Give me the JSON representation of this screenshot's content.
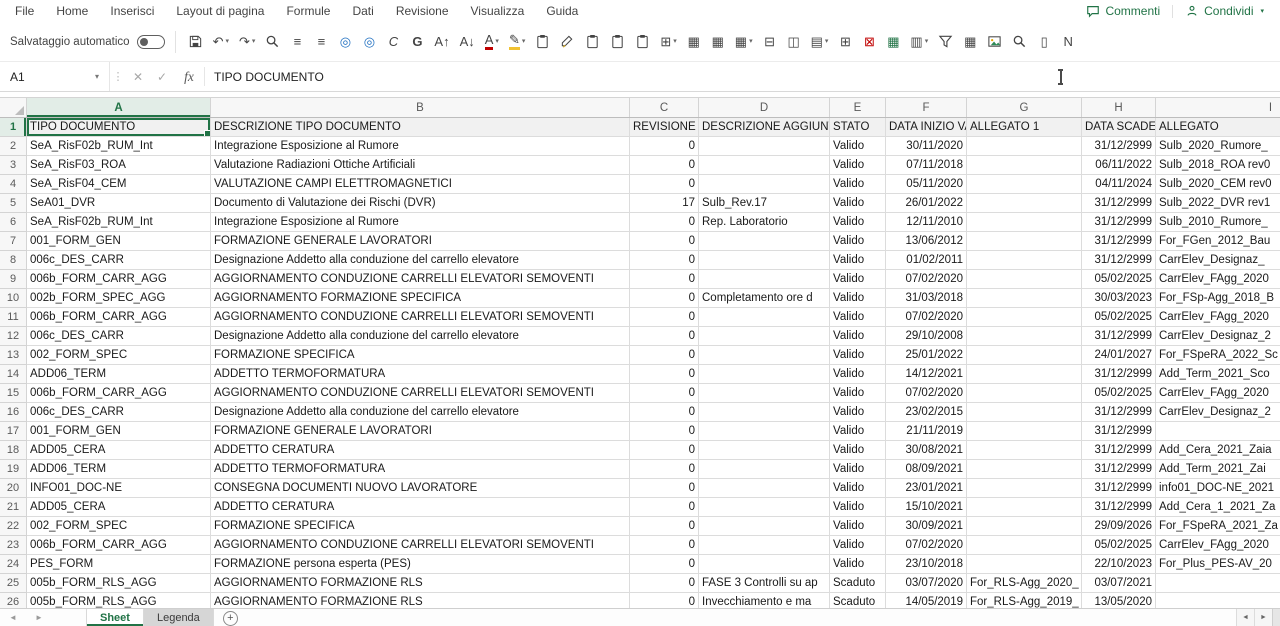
{
  "accent": "#217346",
  "menubar": {
    "items": [
      "File",
      "Home",
      "Inserisci",
      "Layout di pagina",
      "Formule",
      "Dati",
      "Revisione",
      "Visualizza",
      "Guida"
    ],
    "comments_label": "Commenti",
    "share_label": "Condividi"
  },
  "toolbar": {
    "autosave_label": "Salvataggio automatico",
    "autosave_state": "off",
    "icons": [
      {
        "name": "save-icon",
        "svg": "floppy"
      },
      {
        "name": "undo-icon",
        "glyph": "↶",
        "dd": true
      },
      {
        "name": "redo-icon",
        "glyph": "↷",
        "dd": true
      },
      {
        "name": "search-icon",
        "svg": "magnifier"
      },
      {
        "name": "align-justify-icon",
        "glyph": "≡"
      },
      {
        "name": "align-left-icon",
        "glyph": "≡"
      },
      {
        "name": "record-circle-icon",
        "glyph": "◎",
        "color": "#1f6fc0"
      },
      {
        "name": "record-circle-2-icon",
        "glyph": "◎",
        "color": "#1f6fc0"
      },
      {
        "name": "italic-icon",
        "glyph": "C",
        "italic": true
      },
      {
        "name": "bold-icon",
        "glyph": "G",
        "bold": true
      },
      {
        "name": "font-increase-icon",
        "glyph": "A↑"
      },
      {
        "name": "font-decrease-icon",
        "glyph": "A↓"
      },
      {
        "name": "font-color-icon",
        "glyph": "A",
        "bar": "#c00000",
        "dd": true
      },
      {
        "name": "highlight-color-icon",
        "glyph": "✎",
        "bar": "#f1c232",
        "dd": true
      },
      {
        "name": "paste-icon",
        "svg": "clipboard"
      },
      {
        "name": "format-painter-icon",
        "svg": "brush"
      },
      {
        "name": "copy-icon",
        "svg": "clipboard"
      },
      {
        "name": "paste-values-icon",
        "svg": "clipboard"
      },
      {
        "name": "paste-special-icon",
        "svg": "clipboard"
      },
      {
        "name": "borders-icon",
        "glyph": "⊞",
        "dd": true
      },
      {
        "name": "insert-table-icon",
        "glyph": "▦"
      },
      {
        "name": "format-table-icon",
        "glyph": "▦"
      },
      {
        "name": "table-design-icon",
        "glyph": "▦",
        "dd": true
      },
      {
        "name": "cell-size-icon",
        "glyph": "⊟"
      },
      {
        "name": "merge-center-icon",
        "glyph": "◫"
      },
      {
        "name": "cell-styles-icon",
        "glyph": "▤",
        "dd": true
      },
      {
        "name": "insert-cells-icon",
        "glyph": "⊞"
      },
      {
        "name": "delete-cells-icon",
        "glyph": "⊠",
        "color": "#c00000"
      },
      {
        "name": "new-sheet-icon",
        "glyph": "▦",
        "color": "#217346"
      },
      {
        "name": "pivot-table-icon",
        "glyph": "▥",
        "dd": true
      },
      {
        "name": "filter-icon",
        "svg": "funnel"
      },
      {
        "name": "freeze-panes-icon",
        "glyph": "▦"
      },
      {
        "name": "picture-icon",
        "svg": "picture"
      },
      {
        "name": "zoom-sheet-icon",
        "svg": "magnifier"
      },
      {
        "name": "page-layout-icon",
        "glyph": "▯"
      },
      {
        "name": "send-to-onenote-icon",
        "glyph": "N"
      }
    ]
  },
  "formula_bar": {
    "name_box": "A1",
    "cancel_glyph": "✕",
    "enter_glyph": "✓",
    "fx_label": "fx",
    "value": "TIPO DOCUMENTO"
  },
  "grid": {
    "column_letters": [
      "A",
      "B",
      "C",
      "D",
      "E",
      "F",
      "G",
      "H",
      "I"
    ],
    "selected_column": "A",
    "selected_row": 1,
    "active_cell": "A1",
    "rows": [
      [
        "TIPO DOCUMENTO",
        "DESCRIZIONE TIPO DOCUMENTO",
        "REVISIONE",
        "DESCRIZIONE AGGIUNTIVA",
        "STATO",
        "DATA INIZIO VALIDITA'",
        "ALLEGATO 1",
        "DATA SCADENZA",
        "ALLEGATO"
      ],
      [
        "SeA_RisF02b_RUM_Int",
        "Integrazione Esposizione al Rumore",
        "0",
        "",
        "Valido",
        "30/11/2020",
        "",
        "31/12/2999",
        "Sulb_2020_Rumore_"
      ],
      [
        "SeA_RisF03_ROA",
        "Valutazione Radiazioni Ottiche Artificiali",
        "0",
        "",
        "Valido",
        "07/11/2018",
        "",
        "06/11/2022",
        "Sulb_2018_ROA rev0"
      ],
      [
        "SeA_RisF04_CEM",
        "VALUTAZIONE CAMPI ELETTROMAGNETICI",
        "0",
        "",
        "Valido",
        "05/11/2020",
        "",
        "04/11/2024",
        "Sulb_2020_CEM rev0"
      ],
      [
        "SeA01_DVR",
        "Documento di Valutazione dei Rischi (DVR)",
        "17",
        "Sulb_Rev.17",
        "Valido",
        "26/01/2022",
        "",
        "31/12/2999",
        "Sulb_2022_DVR rev1"
      ],
      [
        "SeA_RisF02b_RUM_Int",
        "Integrazione Esposizione al Rumore",
        "0",
        "Rep. Laboratorio",
        "Valido",
        "12/11/2010",
        "",
        "31/12/2999",
        "Sulb_2010_Rumore_"
      ],
      [
        "001_FORM_GEN",
        "FORMAZIONE GENERALE LAVORATORI",
        "0",
        "",
        "Valido",
        "13/06/2012",
        "",
        "31/12/2999",
        "For_FGen_2012_Bau"
      ],
      [
        "006c_DES_CARR",
        "Designazione Addetto alla conduzione del carrello elevatore",
        "0",
        "",
        "Valido",
        "01/02/2011",
        "",
        "31/12/2999",
        "CarrElev_Designaz_"
      ],
      [
        "006b_FORM_CARR_AGG",
        "AGGIORNAMENTO CONDUZIONE CARRELLI ELEVATORI SEMOVENTI",
        "0",
        "",
        "Valido",
        "07/02/2020",
        "",
        "05/02/2025",
        "CarrElev_FAgg_2020"
      ],
      [
        "002b_FORM_SPEC_AGG",
        "AGGIORNAMENTO FORMAZIONE SPECIFICA",
        "0",
        "Completamento ore d",
        "Valido",
        "31/03/2018",
        "",
        "30/03/2023",
        "For_FSp-Agg_2018_B"
      ],
      [
        "006b_FORM_CARR_AGG",
        "AGGIORNAMENTO CONDUZIONE CARRELLI ELEVATORI SEMOVENTI",
        "0",
        "",
        "Valido",
        "07/02/2020",
        "",
        "05/02/2025",
        "CarrElev_FAgg_2020"
      ],
      [
        "006c_DES_CARR",
        "Designazione Addetto alla conduzione del carrello elevatore",
        "0",
        "",
        "Valido",
        "29/10/2008",
        "",
        "31/12/2999",
        "CarrElev_Designaz_2"
      ],
      [
        "002_FORM_SPEC",
        "FORMAZIONE SPECIFICA",
        "0",
        "",
        "Valido",
        "25/01/2022",
        "",
        "24/01/2027",
        "For_FSpeRA_2022_Sc"
      ],
      [
        "ADD06_TERM",
        "ADDETTO TERMOFORMATURA",
        "0",
        "",
        "Valido",
        "14/12/2021",
        "",
        "31/12/2999",
        "Add_Term_2021_Sco"
      ],
      [
        "006b_FORM_CARR_AGG",
        "AGGIORNAMENTO CONDUZIONE CARRELLI ELEVATORI SEMOVENTI",
        "0",
        "",
        "Valido",
        "07/02/2020",
        "",
        "05/02/2025",
        "CarrElev_FAgg_2020"
      ],
      [
        "006c_DES_CARR",
        "Designazione Addetto alla conduzione del carrello elevatore",
        "0",
        "",
        "Valido",
        "23/02/2015",
        "",
        "31/12/2999",
        "CarrElev_Designaz_2"
      ],
      [
        "001_FORM_GEN",
        "FORMAZIONE GENERALE LAVORATORI",
        "0",
        "",
        "Valido",
        "21/11/2019",
        "",
        "31/12/2999",
        ""
      ],
      [
        "ADD05_CERA",
        "ADDETTO CERATURA",
        "0",
        "",
        "Valido",
        "30/08/2021",
        "",
        "31/12/2999",
        "Add_Cera_2021_Zaia"
      ],
      [
        "ADD06_TERM",
        "ADDETTO TERMOFORMATURA",
        "0",
        "",
        "Valido",
        "08/09/2021",
        "",
        "31/12/2999",
        "Add_Term_2021_Zai"
      ],
      [
        "INFO01_DOC-NE",
        "CONSEGNA DOCUMENTI NUOVO LAVORATORE",
        "0",
        "",
        "Valido",
        "23/01/2021",
        "",
        "31/12/2999",
        "info01_DOC-NE_2021"
      ],
      [
        "ADD05_CERA",
        "ADDETTO CERATURA",
        "0",
        "",
        "Valido",
        "15/10/2021",
        "",
        "31/12/2999",
        "Add_Cera_1_2021_Za"
      ],
      [
        "002_FORM_SPEC",
        "FORMAZIONE SPECIFICA",
        "0",
        "",
        "Valido",
        "30/09/2021",
        "",
        "29/09/2026",
        "For_FSpeRA_2021_Za"
      ],
      [
        "006b_FORM_CARR_AGG",
        "AGGIORNAMENTO CONDUZIONE CARRELLI ELEVATORI SEMOVENTI",
        "0",
        "",
        "Valido",
        "07/02/2020",
        "",
        "05/02/2025",
        "CarrElev_FAgg_2020"
      ],
      [
        "PES_FORM",
        "FORMAZIONE persona esperta (PES)",
        "0",
        "",
        "Valido",
        "23/10/2018",
        "",
        "22/10/2023",
        "For_Plus_PES-AV_20"
      ],
      [
        "005b_FORM_RLS_AGG",
        "AGGIORNAMENTO FORMAZIONE RLS",
        "0",
        "FASE 3 Controlli su ap",
        "Scaduto",
        "03/07/2020",
        "For_RLS-Agg_2020_",
        "03/07/2021",
        ""
      ],
      [
        "005b_FORM_RLS_AGG",
        "AGGIORNAMENTO FORMAZIONE RLS",
        "0",
        "Invecchiamento e ma",
        "Scaduto",
        "14/05/2019",
        "For_RLS-Agg_2019_",
        "13/05/2020",
        ""
      ]
    ]
  },
  "tabbar": {
    "tabs": [
      {
        "label": "Sheet",
        "active": true
      },
      {
        "label": "Legenda",
        "active": false
      }
    ],
    "new_sheet_label": "+"
  }
}
